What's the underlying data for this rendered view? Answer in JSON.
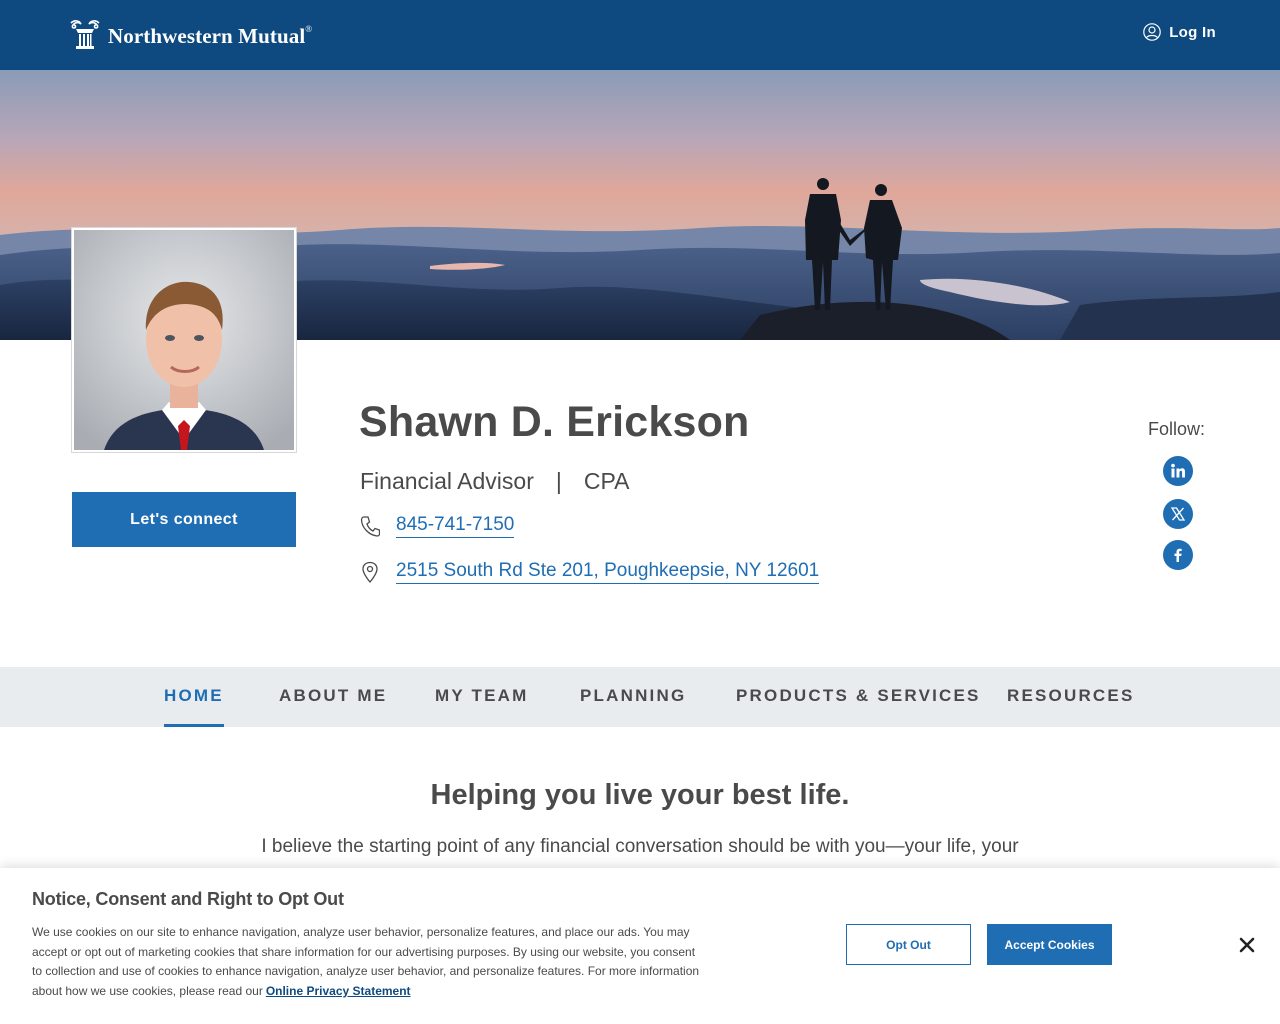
{
  "header": {
    "brand": "Northwestern Mutual",
    "brand_mark": "®",
    "login_label": "Log In",
    "login_icon": "user-circle-icon"
  },
  "hero": {
    "image": "sunset-mountain-couple-photo"
  },
  "profile": {
    "photo": "advisor-portrait-photo",
    "name": "Shawn D. Erickson",
    "title": "Financial Advisor",
    "separator": "|",
    "credential": "CPA",
    "phone": "845-741-7150",
    "phone_icon": "phone-icon",
    "address": "2515 South Rd Ste 201, Poughkeepsie, NY 12601",
    "address_icon": "map-pin-icon",
    "connect_label": "Let's connect"
  },
  "follow": {
    "label": "Follow:",
    "networks": [
      "linkedin",
      "x",
      "facebook"
    ]
  },
  "nav": {
    "items": [
      {
        "label": "HOME",
        "active": true
      },
      {
        "label": "ABOUT ME",
        "active": false
      },
      {
        "label": "MY TEAM",
        "active": false
      },
      {
        "label": "PLANNING",
        "active": false
      },
      {
        "label": "PRODUCTS & SERVICES",
        "active": false
      },
      {
        "label": "RESOURCES",
        "active": false
      }
    ]
  },
  "content": {
    "headline": "Helping you live your best life.",
    "intro": "I believe the starting point of any financial conversation should be with you—your life, your"
  },
  "cookie": {
    "title": "Notice, Consent and Right to Opt Out",
    "text": "We use cookies on our site to enhance navigation, analyze user behavior, personalize features, and place our ads. You may accept or opt out of marketing cookies that share information for our advertising purposes. By using our website, you consent to collection and use of cookies to enhance navigation, analyze user behavior, and personalize features. For more information about how we use cookies, please read our",
    "link_label": "Online Privacy Statement",
    "optout_label": "Opt Out",
    "accept_label": "Accept Cookies",
    "close_icon": "close-icon"
  },
  "colors": {
    "header_bg": "#0e4a7f",
    "accent": "#1f6db3",
    "nav_bg": "#e9ecef",
    "text": "#4a4a4a"
  }
}
